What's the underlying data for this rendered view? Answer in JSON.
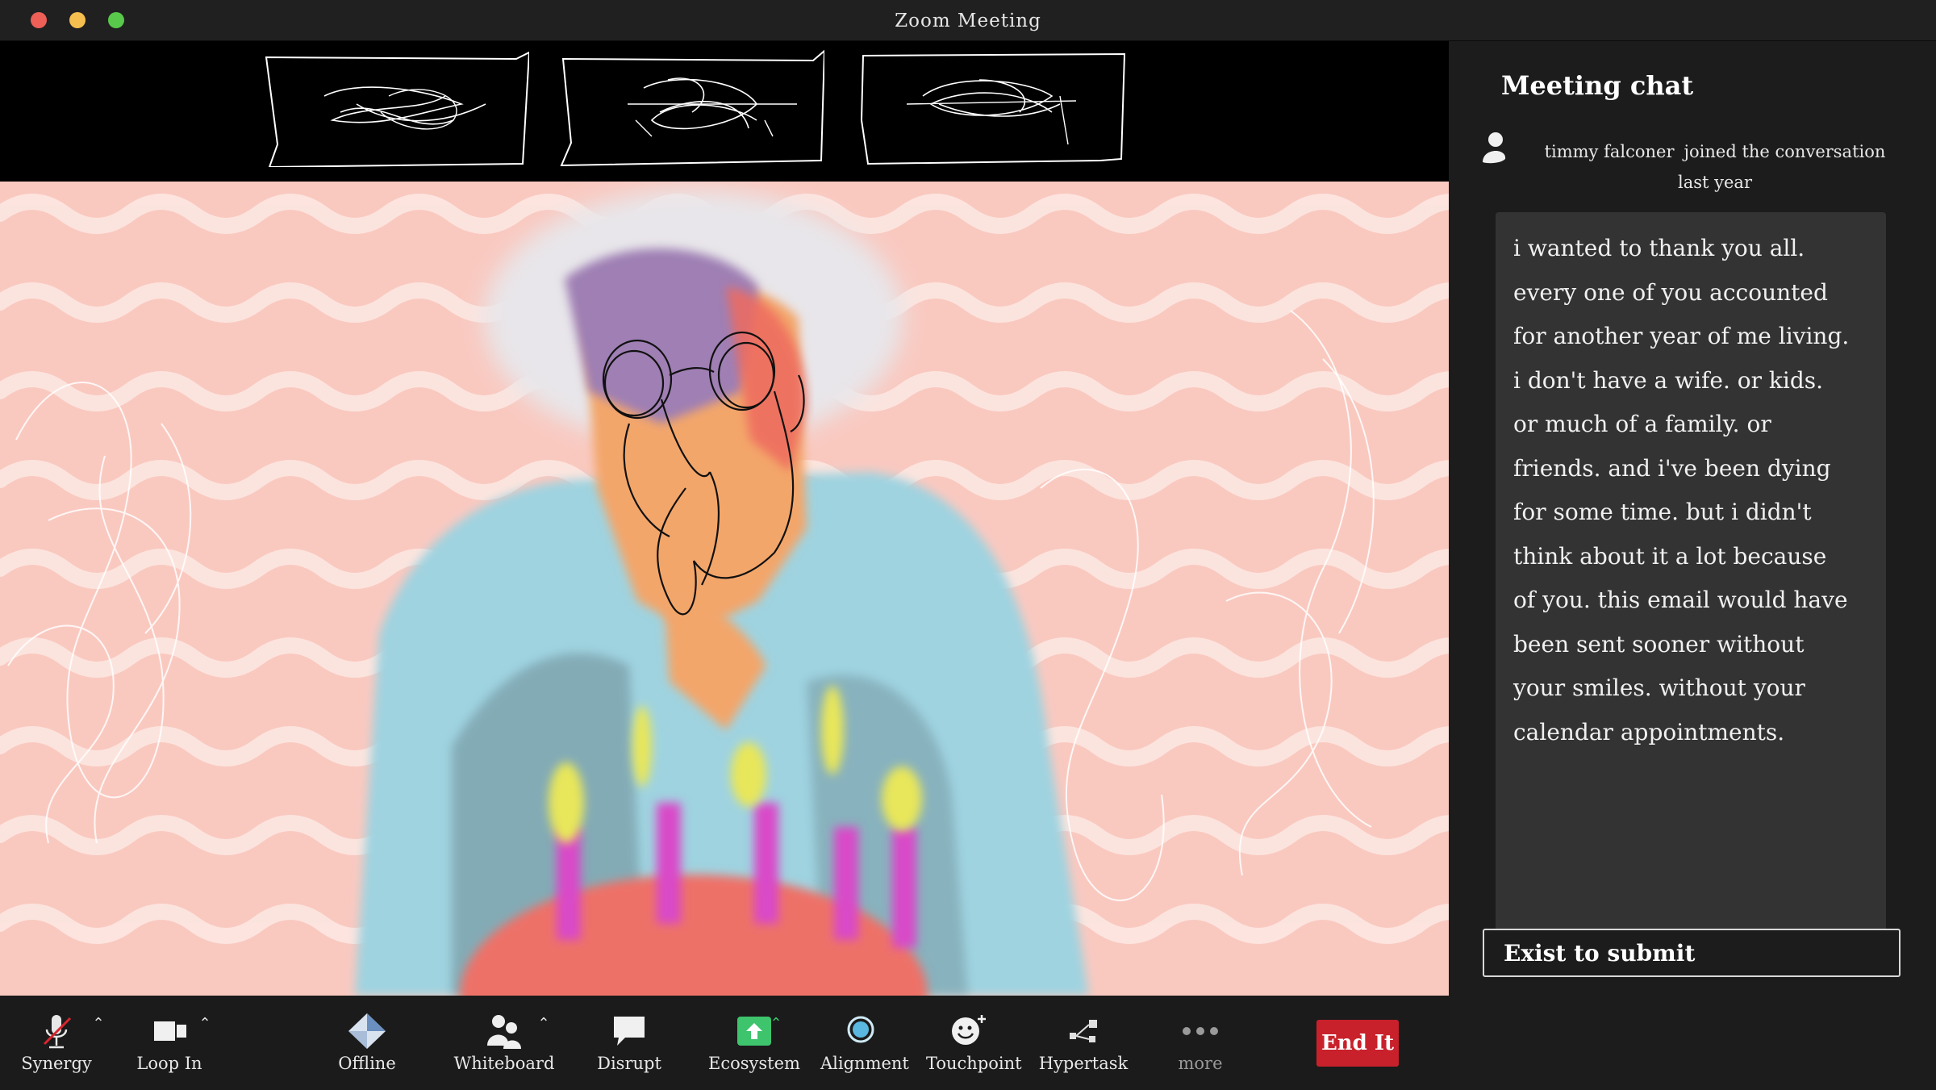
{
  "window": {
    "title": "Zoom Meeting"
  },
  "colors": {
    "titlebar": "#202020",
    "close": "#ee5f57",
    "minimize": "#f5bf4f",
    "maximize": "#58c94a",
    "video_background": "#f9c9c0",
    "end_button": "#c8212b",
    "chat_panel": "#1c1c1c",
    "message_box": "#333333"
  },
  "video": {
    "participant_thumbnails": 3
  },
  "chat": {
    "title": "Meeting chat",
    "join_user": "timmy falconer",
    "join_text": "joined the conversation",
    "join_time": "last year",
    "message": "i wanted to thank you all.\nevery one of you accounted\nfor another year of me living.\ni don't have a wife. or kids.\nor much of a family. or\nfriends. and i've been dying\nfor some time. but i didn't\nthink about it a lot because\nof you. this email would have\nbeen sent sooner without\nyour smiles. without your\ncalendar appointments.",
    "input_label": "Exist to submit"
  },
  "toolbar": {
    "synergy": "Synergy",
    "loop_in": "Loop In",
    "offline": "Offline",
    "whiteboard": "Whiteboard",
    "disrupt": "Disrupt",
    "ecosystem": "Ecosystem",
    "alignment": "Alignment",
    "touchpoint": "Touchpoint",
    "hypertask": "Hypertask",
    "more": "more",
    "end": "End It"
  }
}
